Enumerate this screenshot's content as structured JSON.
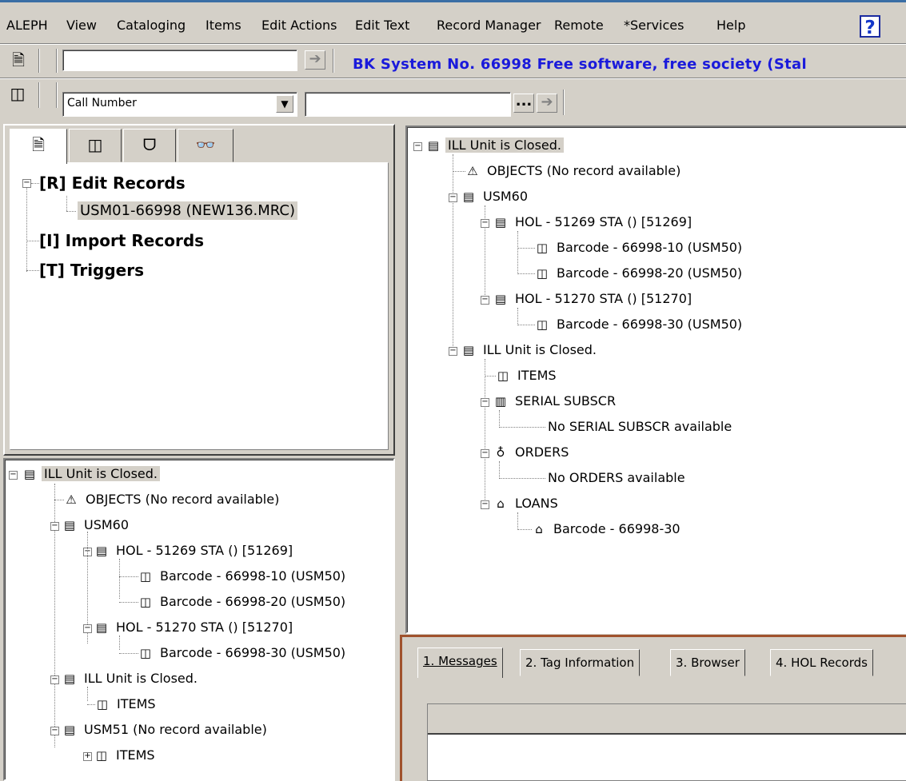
{
  "menu": {
    "items": [
      "ALEPH",
      "View",
      "Cataloging",
      "Items",
      "Edit Actions",
      "Edit Text",
      "Record Manager",
      "Remote",
      "*Services",
      "Help"
    ],
    "help_icon": "?"
  },
  "toolbar1": {
    "input_value": "",
    "status_message": "BK System No. 66998 Free software, free society (Stal"
  },
  "toolbar2": {
    "search_field_selected": "Call Number",
    "search_input_value": "",
    "ellipsis_label": "..."
  },
  "left_tabs": [
    "record-tab",
    "item-tab",
    "trigger-tab",
    "search-tab"
  ],
  "left_tree": {
    "edit_records": "[R] Edit Records",
    "record_item": "USM01-66998 (NEW136.MRC)",
    "import_records": "[I] Import Records",
    "triggers": "[T] Triggers"
  },
  "bottom_left_tree": {
    "ill_closed": "ILL Unit is Closed.",
    "objects": "OBJECTS (No record available)",
    "usm60": "USM60",
    "hol1": "HOL - 51269 STA () [51269]",
    "barcode1": "Barcode - 66998-10 (USM50)",
    "barcode2": "Barcode - 66998-20 (USM50)",
    "hol2": "HOL - 51270 STA () [51270]",
    "barcode3": "Barcode - 66998-30 (USM50)",
    "ill_closed2": "ILL Unit is Closed.",
    "items": "ITEMS",
    "usm51": "USM51 (No record available)",
    "items2": "ITEMS"
  },
  "right_tree": {
    "ill_closed": "ILL Unit is Closed.",
    "objects": "OBJECTS (No record available)",
    "usm60": "USM60",
    "hol1": "HOL - 51269 STA () [51269]",
    "barcode1": "Barcode - 66998-10 (USM50)",
    "barcode2": "Barcode - 66998-20 (USM50)",
    "hol2": "HOL - 51270 STA () [51270]",
    "barcode3": "Barcode - 66998-30 (USM50)",
    "ill_closed2": "ILL Unit is Closed.",
    "items": "ITEMS",
    "serial": "SERIAL SUBSCR",
    "no_serial": "No SERIAL SUBSCR available",
    "orders": "ORDERS",
    "no_orders": "No ORDERS available",
    "loans": "LOANS",
    "loan_barcode": "Barcode - 66998-30"
  },
  "bottom_tabs": [
    "1. Messages",
    "2. Tag Information",
    "3. Browser",
    "4. HOL Records"
  ],
  "colors": {
    "face": "#d4d0c8",
    "status_blue": "#1a1adb",
    "bottom_frame": "#a0522d"
  }
}
